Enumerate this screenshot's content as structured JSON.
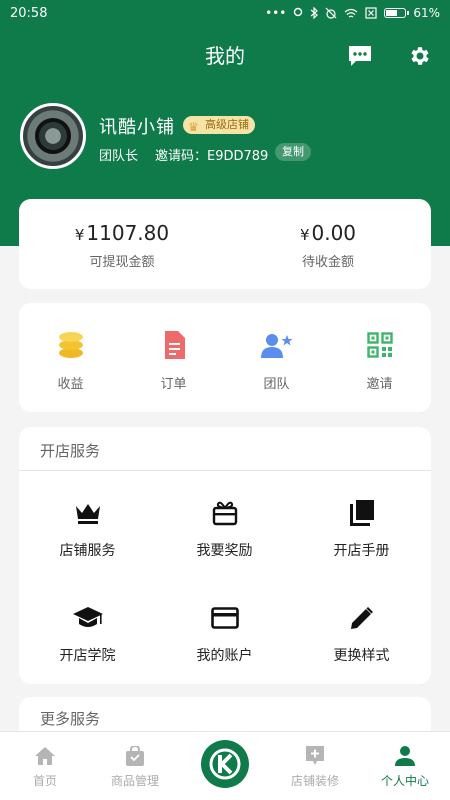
{
  "status": {
    "time": "20:58",
    "battery": "61%",
    "battery_level": 0.61
  },
  "header": {
    "title": "我的"
  },
  "profile": {
    "shop_name": "讯酷小铺",
    "badge": "高级店铺",
    "role": "团队长",
    "invite": "邀请码：E9DD789",
    "copy_label": "复制"
  },
  "balance": {
    "withdrawable": {
      "amount": "1107.80",
      "currency": "¥",
      "label": "可提现金额"
    },
    "pending": {
      "amount": "0.00",
      "currency": "¥",
      "label": "待收金额"
    }
  },
  "quick": [
    {
      "label": "收益",
      "icon": "coins-icon",
      "color": "#f4c430"
    },
    {
      "label": "订单",
      "icon": "document-icon",
      "color": "#ee6b6b"
    },
    {
      "label": "团队",
      "icon": "team-icon",
      "color": "#5b8def"
    },
    {
      "label": "邀请",
      "icon": "qrcode-icon",
      "color": "#3cb56c"
    }
  ],
  "services": {
    "title": "开店服务",
    "items": [
      {
        "label": "店铺服务",
        "icon": "crown-icon"
      },
      {
        "label": "我要奖励",
        "icon": "gift-icon"
      },
      {
        "label": "开店手册",
        "icon": "book-icon"
      },
      {
        "label": "开店学院",
        "icon": "graduation-cap-icon"
      },
      {
        "label": "我的账户",
        "icon": "credit-card-icon"
      },
      {
        "label": "更换样式",
        "icon": "pencil-icon"
      }
    ]
  },
  "more": {
    "title": "更多服务"
  },
  "tabs": [
    {
      "label": "首页",
      "icon": "home-icon"
    },
    {
      "label": "商品管理",
      "icon": "bag-icon"
    },
    {
      "label": "",
      "icon": "logo-k-icon"
    },
    {
      "label": "店铺装修",
      "icon": "decor-icon"
    },
    {
      "label": "个人中心",
      "icon": "person-icon",
      "active": true
    }
  ],
  "colors": {
    "primary": "#0f7a4a",
    "background": "#f4f4f4",
    "badge_bg": "#f6e3a6"
  }
}
